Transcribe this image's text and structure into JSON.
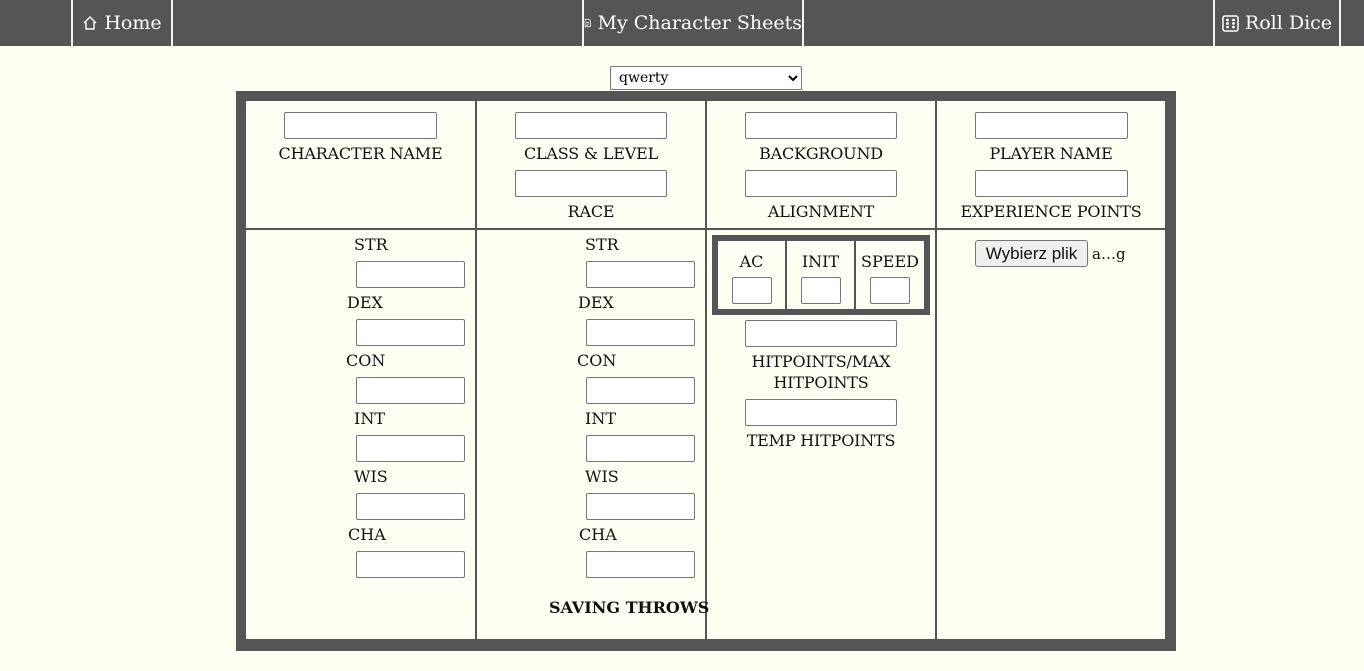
{
  "nav": {
    "home": "Home",
    "sheets": "My Character Sheets",
    "dice": "Roll Dice"
  },
  "character_select": {
    "value": "qwerty",
    "options": [
      "qwerty"
    ]
  },
  "header": {
    "character_name": "CHARACTER NAME",
    "class_level": "CLASS & LEVEL",
    "race": "RACE",
    "background": "BACKGROUND",
    "alignment": "ALIGNMENT",
    "player_name": "PLAYER NAME",
    "experience_points": "EXPERIENCE POINTS"
  },
  "abilities": [
    "STR",
    "DEX",
    "CON",
    "INT",
    "WIS",
    "CHA"
  ],
  "saving_throws": {
    "labels": [
      "STR",
      "DEX",
      "CON",
      "INT",
      "WIS",
      "CHA"
    ],
    "title": "SAVING THROWS"
  },
  "combat": {
    "ac": "AC",
    "init": "INIT",
    "speed": "SPEED",
    "hitpoints": "HITPOINTS/MAX",
    "hitpoints2": "HITPOINTS",
    "temp_hitpoints": "TEMP HITPOINTS"
  },
  "file": {
    "button": "Wybierz plik",
    "name": "a…g"
  },
  "colors": {
    "nav_bg": "#555555",
    "page_bg": "#fffff4",
    "border": "#555555"
  }
}
